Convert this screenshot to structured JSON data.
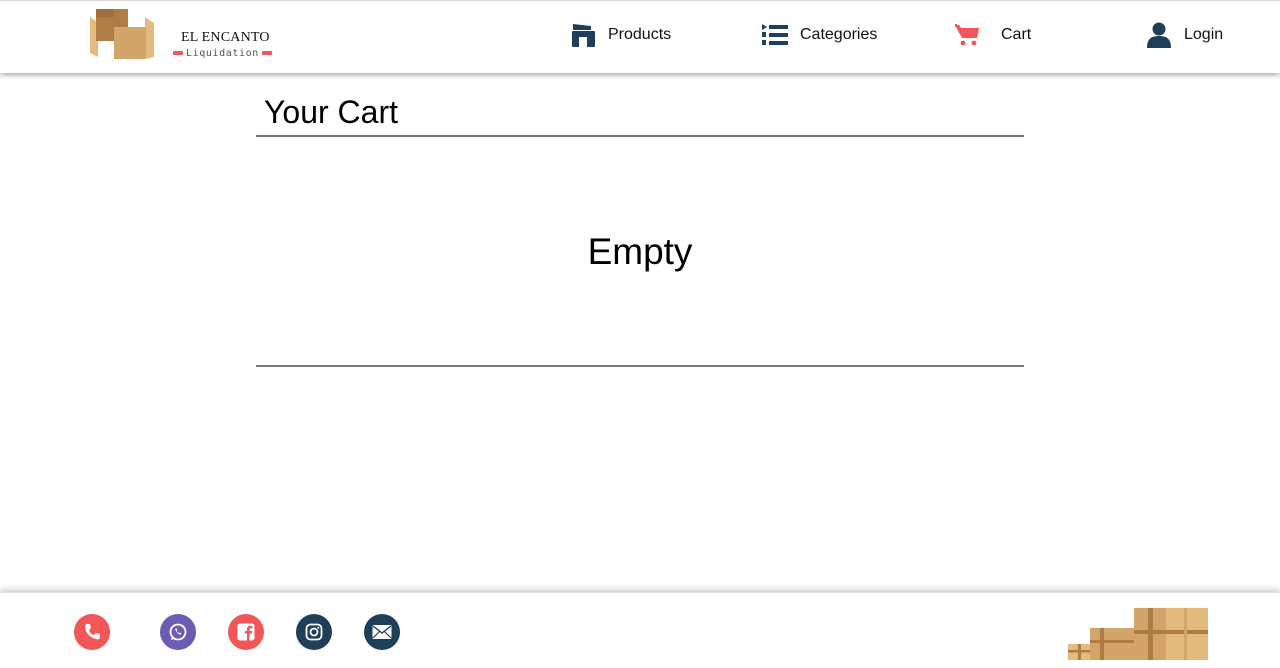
{
  "brand": {
    "name": "EL ENCANTO",
    "tagline": "Liquidation",
    "colors": {
      "box_light": "#e4bb7e",
      "box_dark": "#b07c45",
      "accent_red": "#f0575a"
    }
  },
  "nav": {
    "items": [
      {
        "label": "Products",
        "icon": "store-icon"
      },
      {
        "label": "Categories",
        "icon": "list-icon"
      },
      {
        "label": "Cart",
        "icon": "cart-icon"
      },
      {
        "label": "Login",
        "icon": "user-icon"
      }
    ],
    "icon_color": "#1f3e59",
    "cart_icon_color": "#f35657"
  },
  "main": {
    "title": "Your Cart",
    "empty_message": "Empty"
  },
  "footer": {
    "social": [
      {
        "name": "phone",
        "icon": "phone-icon",
        "color": "#f35657"
      },
      {
        "name": "whatsapp",
        "icon": "whatsapp-icon",
        "color": "#6b5bb3"
      },
      {
        "name": "facebook",
        "icon": "facebook-icon",
        "color": "#f35657"
      },
      {
        "name": "instagram",
        "icon": "instagram-icon",
        "color": "#1f3e59"
      },
      {
        "name": "email",
        "icon": "mail-icon",
        "color": "#1f3e59"
      }
    ]
  }
}
